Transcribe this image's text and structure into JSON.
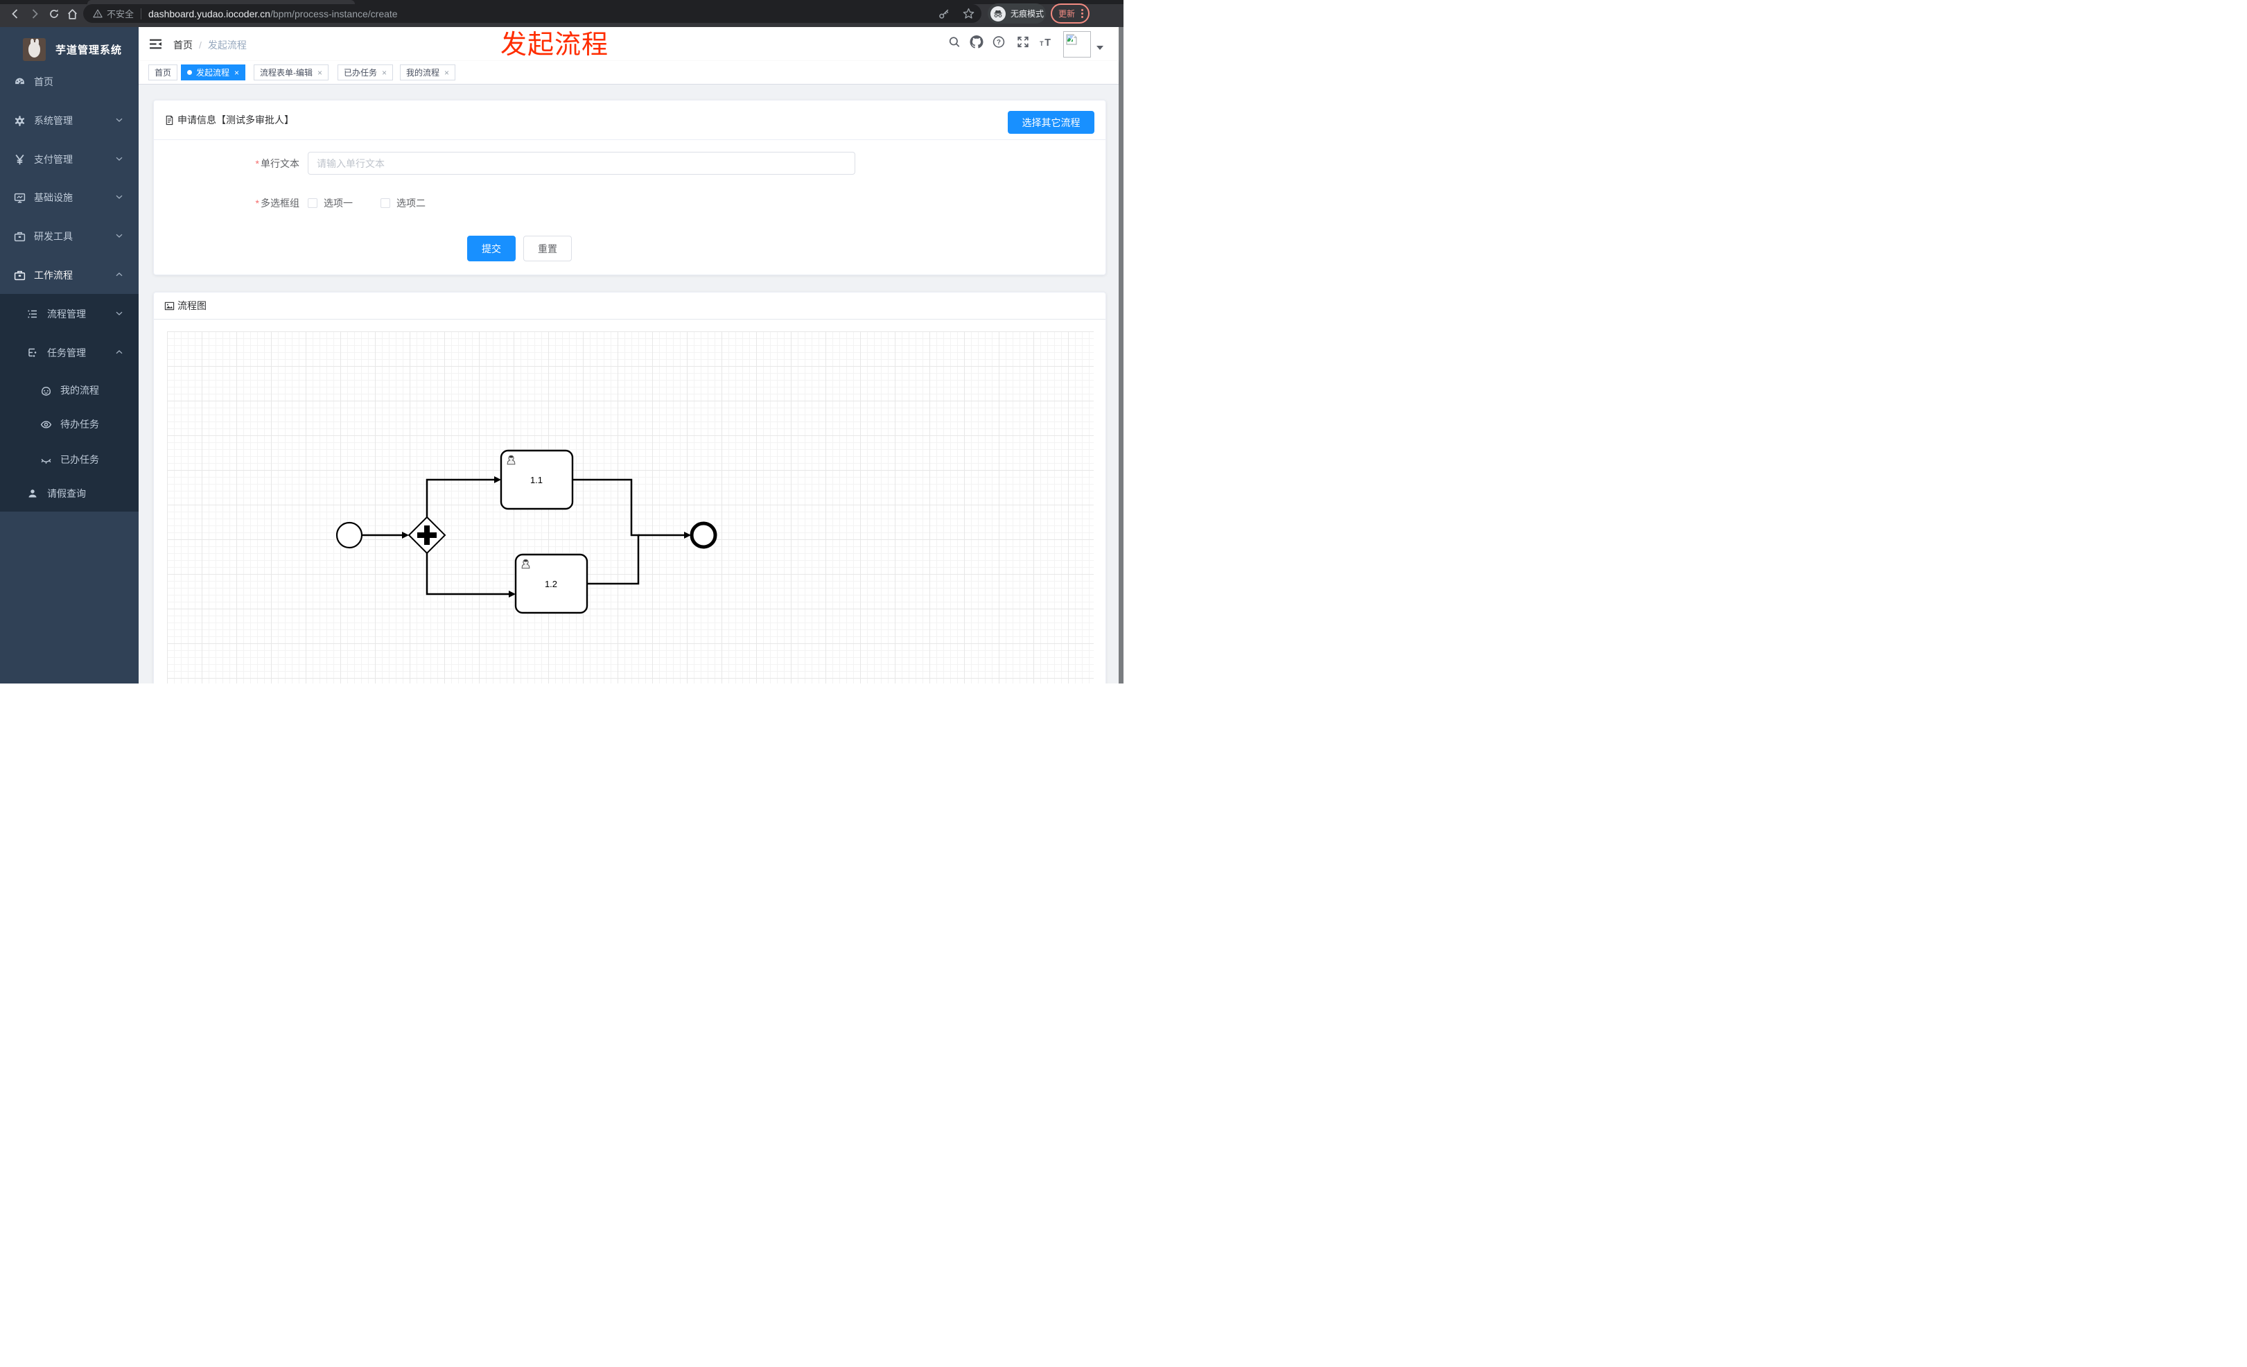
{
  "browser": {
    "security_label": "不安全",
    "url_host": "dashboard.yudao.iocoder.cn",
    "url_path": "/bpm/process-instance/create",
    "incognito_label": "无痕模式",
    "update_label": "更新"
  },
  "annotation": {
    "text": "发起流程",
    "color": "#ff2d00"
  },
  "sidebar": {
    "title": "芋道管理系统",
    "items": [
      {
        "label": "首页"
      },
      {
        "label": "系统管理"
      },
      {
        "label": "支付管理"
      },
      {
        "label": "基础设施"
      },
      {
        "label": "研发工具"
      },
      {
        "label": "工作流程"
      },
      {
        "label": "流程管理"
      },
      {
        "label": "任务管理"
      },
      {
        "label": "我的流程"
      },
      {
        "label": "待办任务"
      },
      {
        "label": "已办任务"
      },
      {
        "label": "请假查询"
      }
    ]
  },
  "header": {
    "breadcrumb": [
      "首页",
      "发起流程"
    ]
  },
  "tags": [
    {
      "label": "首页"
    },
    {
      "label": "发起流程",
      "active": true
    },
    {
      "label": "流程表单-编辑"
    },
    {
      "label": "已办任务"
    },
    {
      "label": "我的流程"
    }
  ],
  "form_card": {
    "title": "申请信息【测试多审批人】",
    "switch_button": "选择其它流程",
    "fields": {
      "text_label": "单行文本",
      "text_placeholder": "请输入单行文本",
      "checkbox_label": "多选框组",
      "option1": "选项一",
      "option2": "选项二"
    },
    "submit": "提交",
    "reset": "重置"
  },
  "diagram_card": {
    "title": "流程图",
    "diagram": {
      "type": "bpmn",
      "nodes": [
        {
          "id": "start",
          "type": "startEvent"
        },
        {
          "id": "gateway",
          "type": "parallelGateway"
        },
        {
          "id": "task-1-1",
          "type": "userTask",
          "label": "1.1"
        },
        {
          "id": "task-1-2",
          "type": "userTask",
          "label": "1.2"
        },
        {
          "id": "end",
          "type": "endEvent"
        }
      ],
      "flows": [
        "start -> gateway",
        "gateway -> task-1-1",
        "gateway -> task-1-2",
        "task-1-1 -> end",
        "task-1-2 -> end"
      ]
    }
  },
  "colors": {
    "primary": "#1890ff",
    "sidebar_bg": "#304156",
    "sidebar_submenu_bg": "#1f2d3d",
    "update_red": "#f28b82",
    "annotation_red": "#ff2d00"
  }
}
